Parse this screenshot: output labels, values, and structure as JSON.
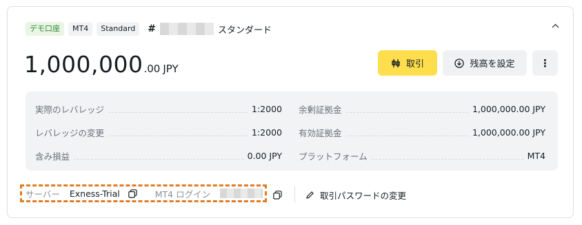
{
  "header": {
    "tags": [
      "デモ口座",
      "MT4",
      "Standard"
    ],
    "hash": "#",
    "account_type": "スタンダード",
    "collapse_icon": "chevron-up-icon"
  },
  "balance": {
    "integer": "1,000,000",
    "decimal": ".00",
    "currency": "JPY"
  },
  "actions": {
    "trade_label": "取引",
    "set_balance_label": "残高を設定",
    "more_label": "⋮"
  },
  "stats": {
    "left": [
      {
        "label": "実際のレバレッジ",
        "value": "1:2000"
      },
      {
        "label": "レバレッジの変更",
        "value": "1:2000"
      },
      {
        "label": "含み損益",
        "value": "0.00 JPY"
      }
    ],
    "right": [
      {
        "label": "余剰証拠金",
        "value": "1,000,000.00 JPY"
      },
      {
        "label": "有効証拠金",
        "value": "1,000,000.00 JPY"
      },
      {
        "label": "プラットフォーム",
        "value": "MT4"
      }
    ]
  },
  "footer": {
    "server_label": "サーバー",
    "server_value": "Exness-Trial",
    "login_label": "MT4 ログイン",
    "change_password_label": "取引パスワードの変更"
  },
  "colors": {
    "accent_button": "#ffde4d",
    "demo_tag_text": "#2f8a3b",
    "highlight_border": "#e07b22"
  }
}
